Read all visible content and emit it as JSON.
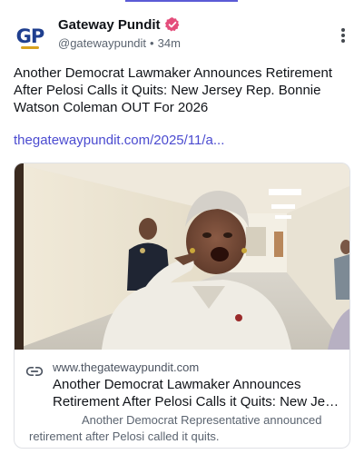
{
  "post": {
    "author": {
      "display_name": "Gateway Pundit",
      "handle": "@gatewaypundit",
      "time_ago": "34m",
      "separator": "•",
      "avatar_text": "GP",
      "verified": true,
      "verified_color": "#e44d7b"
    },
    "text_lines": [
      "Another Democrat Lawmaker Announces Retirement",
      "After Pelosi Calls it Quits: New Jersey Rep. Bonnie",
      "Watson Coleman OUT For 2026"
    ],
    "link_text": "thegatewaypundit.com/2025/11/a...",
    "link_color": "#4b4bd0",
    "more_icon": "vertical-dots-icon"
  },
  "link_card": {
    "domain": "www.thegatewaypundit.com",
    "title_lines": [
      "Another Democrat Lawmaker Announces",
      "Retirement After Pelosi Calls it Quits: New Jers..."
    ],
    "description_lines": [
      "Another Democrat Representative announced",
      "retirement after Pelosi called it quits."
    ],
    "icon": "link-icon"
  },
  "colors": {
    "accent": "#5b5bd6",
    "text": "#101318",
    "muted": "#5b6470",
    "border": "#dfe1e6"
  }
}
